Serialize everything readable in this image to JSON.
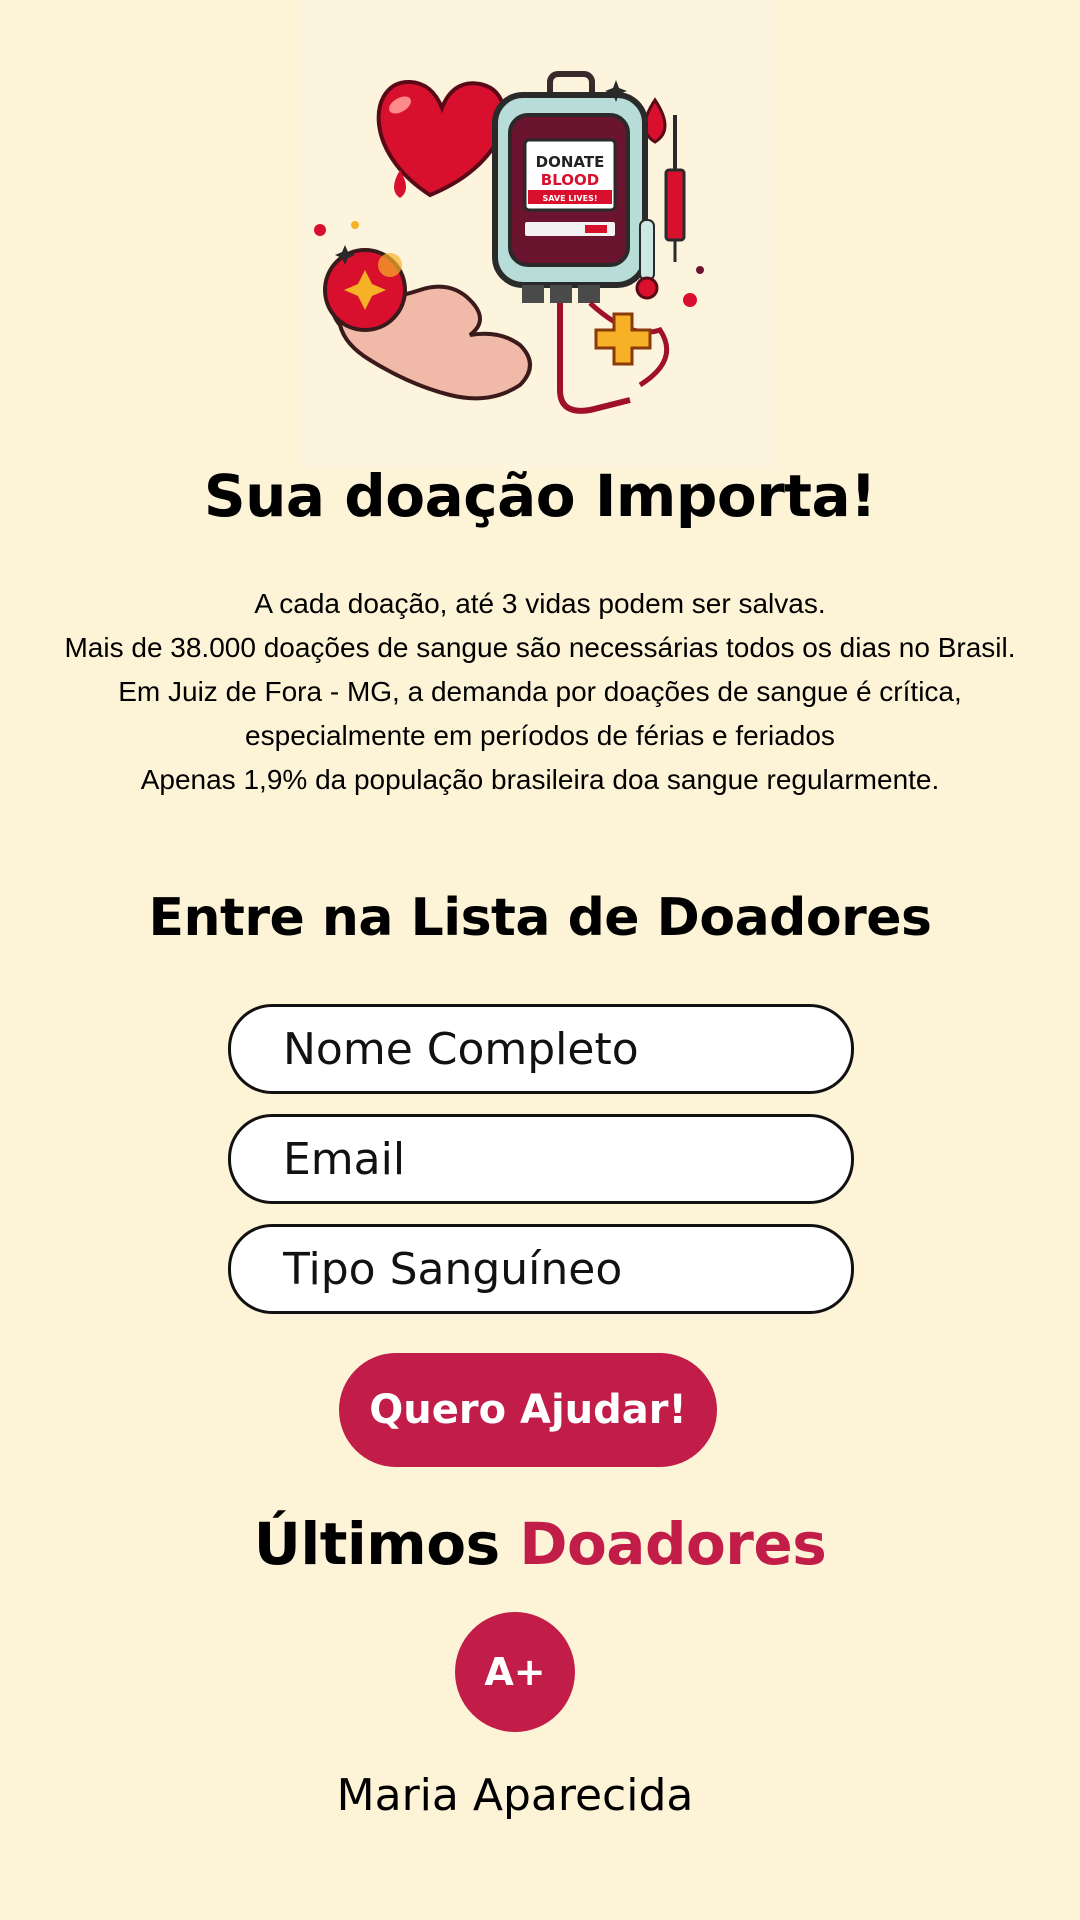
{
  "hero": {
    "illustration": "blood-bag-heart-hand-illustration",
    "bag_label_line1": "DONATE",
    "bag_label_line2": "BLOOD",
    "bag_label_line3": "SAVE LIVES!"
  },
  "title": "Sua doação Importa!",
  "intro": {
    "line1": "A cada doação, até 3 vidas podem ser salvas.",
    "line2": "Mais de 38.000 doações de sangue são necessárias todos os dias no Brasil.",
    "line3": "Em Juiz de Fora - MG, a demanda por doações de sangue é crítica, especialmente em períodos de férias e feriados",
    "line4": "Apenas 1,9% da população brasileira doa sangue regularmente."
  },
  "form": {
    "heading": "Entre na Lista de Doadores",
    "name_placeholder": "Nome Completo",
    "email_placeholder": "Email",
    "blood_type_placeholder": "Tipo Sanguíneo",
    "submit_label": "Quero Ajudar!"
  },
  "donors": {
    "heading_part1": "Últimos",
    "heading_part2": "Doadores",
    "items": [
      {
        "blood_type": "A+",
        "name": "Maria Aparecida"
      }
    ]
  },
  "colors": {
    "background": "#fdf3d6",
    "accent": "#c21c48"
  }
}
